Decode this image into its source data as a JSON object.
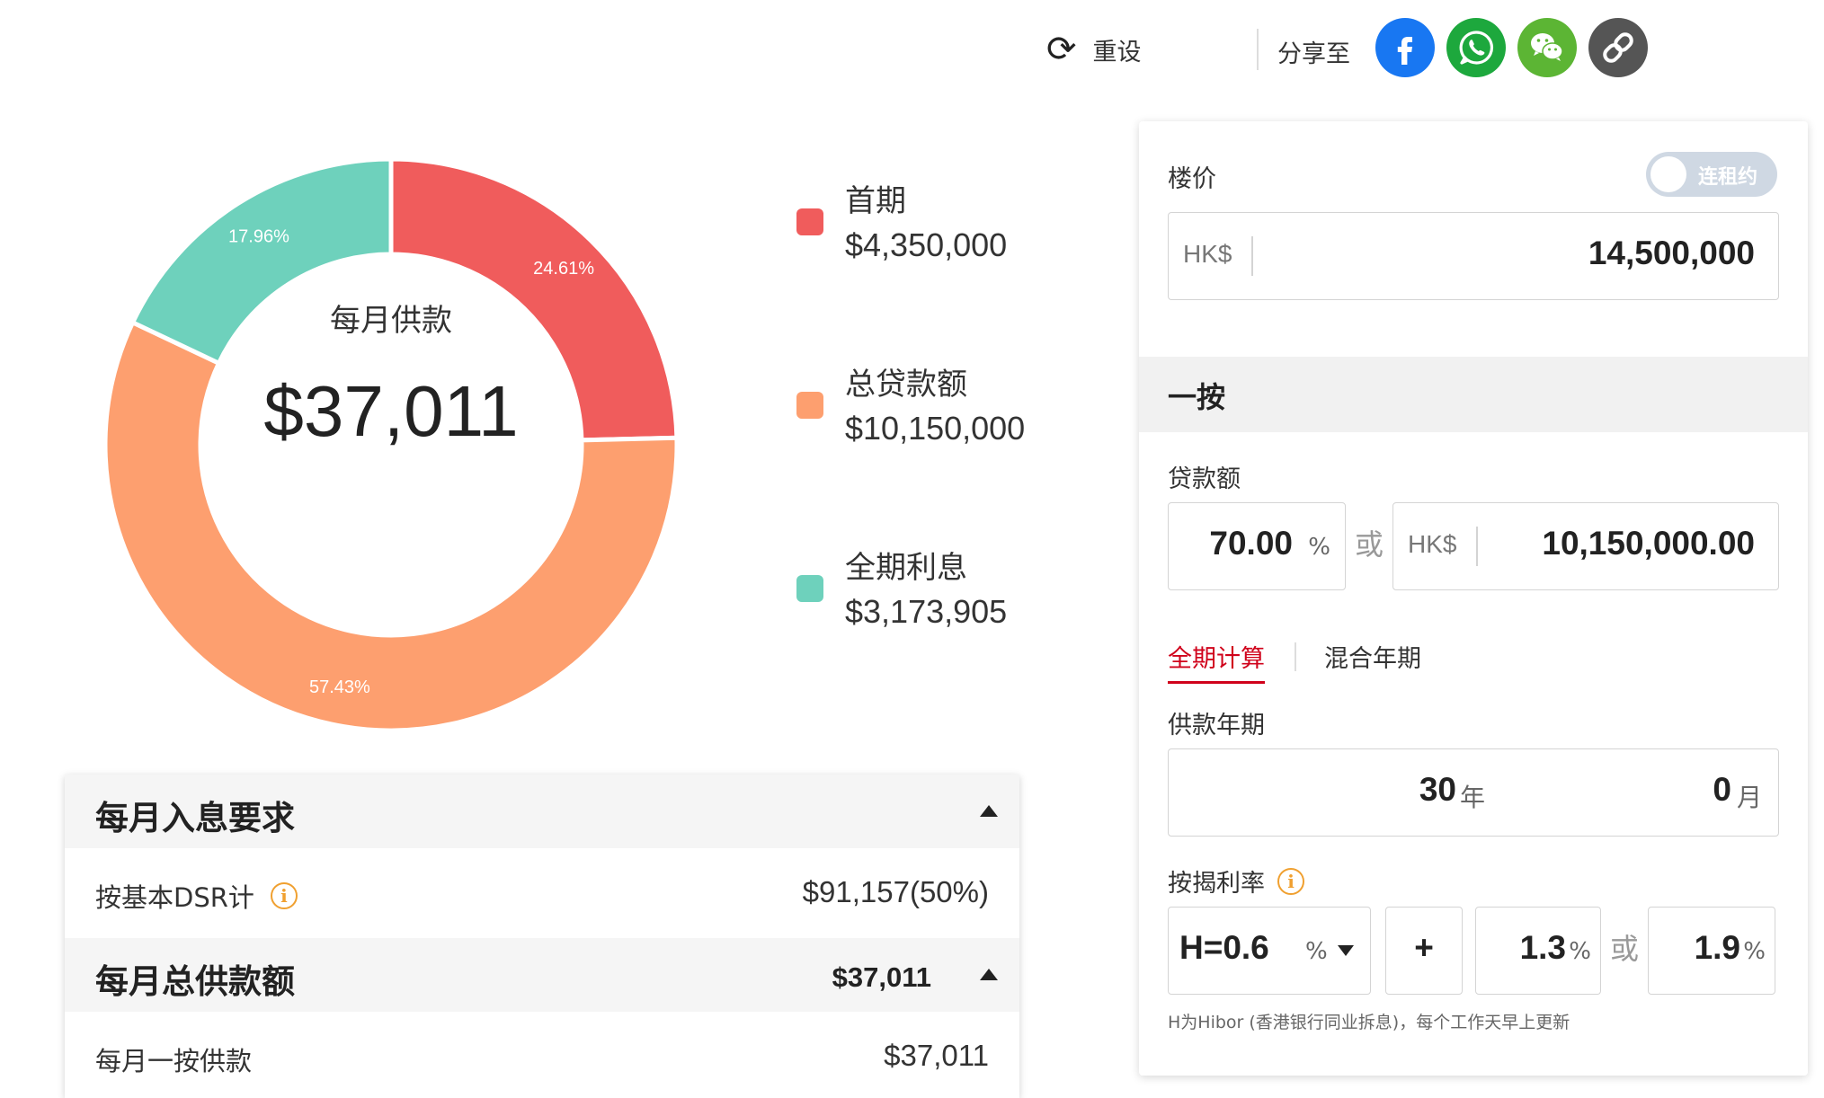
{
  "toolbar": {
    "reset_label": "重设",
    "share_label": "分享至",
    "share_buttons": [
      {
        "name": "facebook",
        "icon": "facebook-icon",
        "color": "#1877f2"
      },
      {
        "name": "whatsapp",
        "icon": "whatsapp-icon",
        "color": "#1da83d"
      },
      {
        "name": "wechat",
        "icon": "wechat-icon",
        "color": "#5cb534"
      },
      {
        "name": "copy-link",
        "icon": "link-icon",
        "color": "#555555"
      }
    ]
  },
  "chart_data": {
    "type": "pie",
    "donut": true,
    "center_label": "每月供款",
    "center_value": "$37,011",
    "slices": [
      {
        "name": "首期",
        "value": 4350000,
        "display_value": "$4,350,000",
        "percent": 24.61,
        "percent_label": "24.61%",
        "color": "#f05c5c"
      },
      {
        "name": "总贷款额",
        "value": 10150000,
        "display_value": "$10,150,000",
        "percent": 57.43,
        "percent_label": "57.43%",
        "color": "#fd9f6f"
      },
      {
        "name": "全期利息",
        "value": 3173905,
        "display_value": "$3,173,905",
        "percent": 17.96,
        "percent_label": "17.96%",
        "color": "#6ed1bc"
      }
    ]
  },
  "income_panel": {
    "title": "每月入息要求",
    "dsr_label": "按基本DSR计",
    "dsr_value": "$91,157(50%)",
    "total_title": "每月总供款额",
    "total_value": "$37,011",
    "first_mortgage_label": "每月一按供款",
    "first_mortgage_value": "$37,011"
  },
  "form": {
    "price_label": "楼价",
    "tenancy_toggle": "连租约",
    "currency": "HK$",
    "price_value": "14,500,000",
    "section_title": "一按",
    "loan_label": "贷款额",
    "loan_percent": "70.00",
    "percent_unit": "%",
    "or_text": "或",
    "loan_amount": "10,150,000.00",
    "tabs": [
      {
        "label": "全期计算",
        "active": true
      },
      {
        "label": "混合年期",
        "active": false
      }
    ],
    "term_label": "供款年期",
    "term_years": "30",
    "years_unit": "年",
    "term_months": "0",
    "months_unit": "月",
    "rate_label": "按揭利率",
    "rate_base": "H=0.6",
    "rate_plus": "+",
    "rate_spread": "1.3",
    "rate_cap": "1.9",
    "note": "H为Hibor (香港银行同业拆息)，每个工作天早上更新"
  },
  "colors": {
    "accent_red": "#d0021b",
    "info_orange": "#f0a030"
  }
}
